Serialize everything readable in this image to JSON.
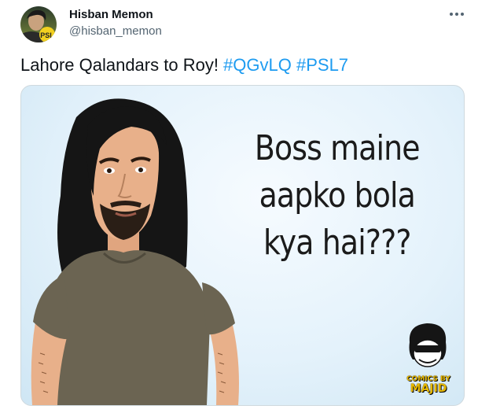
{
  "tweet": {
    "author": {
      "display_name": "Hisban Memon",
      "handle": "@hisban_memon",
      "avatar_badge": "PSL"
    },
    "text_prefix": "Lahore Qalandars to Roy! ",
    "hashtags": [
      "#QGvLQ",
      "#PSL7"
    ],
    "more_icon": "more-horizontal-icon",
    "media": {
      "speech_lines": [
        "Boss maine",
        "aapko bola",
        "kya hai???"
      ],
      "brand_line1": "COMICS BY",
      "brand_line2": "MAJID"
    }
  },
  "colors": {
    "hashtag": "#1d9bf0",
    "secondary_text": "#536471",
    "border": "#cfd9de",
    "media_background": "#e4f2fb",
    "shirt": "#6b6452",
    "skin": "#e8b08a",
    "hair": "#151515",
    "brand_yellow": "#e7b800"
  }
}
